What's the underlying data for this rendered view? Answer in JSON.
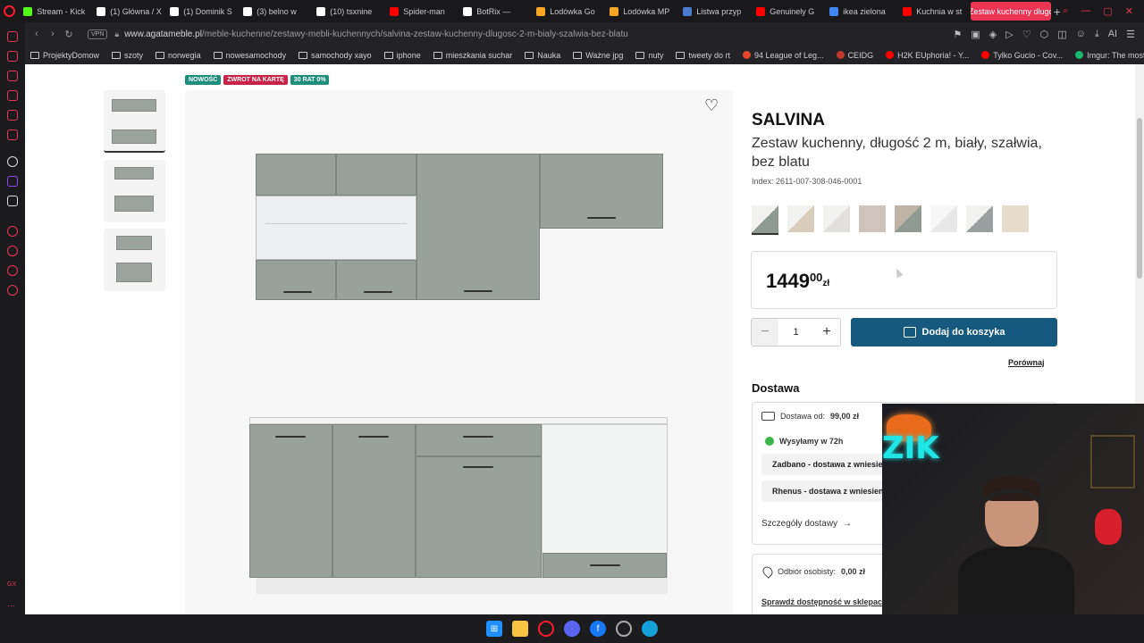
{
  "tabs": [
    {
      "label": "Stream - Kick",
      "favicon": "kick",
      "color": "#53fc18"
    },
    {
      "label": "(1) Główna / X",
      "favicon": "x",
      "color": "#ffffff"
    },
    {
      "label": "(1) Dominik S",
      "favicon": "x",
      "color": "#ffffff"
    },
    {
      "label": "(3) belno w",
      "favicon": "x",
      "color": "#ffffff"
    },
    {
      "label": "(10) tsxnine",
      "favicon": "x",
      "color": "#ffffff"
    },
    {
      "label": "Spider-man",
      "favicon": "youtube",
      "color": "#ff0000"
    },
    {
      "label": "BotRix —",
      "favicon": "botrix",
      "color": "#ffffff"
    },
    {
      "label": "Lodówka Go",
      "favicon": "ceneo",
      "color": "#f5a623"
    },
    {
      "label": "Lodówka MP",
      "favicon": "ceneo",
      "color": "#f5a623"
    },
    {
      "label": "Listwa przyp",
      "favicon": "d",
      "color": "#4a7bd0"
    },
    {
      "label": "Genuinely G",
      "favicon": "youtube",
      "color": "#ff0000"
    },
    {
      "label": "ikea zielona",
      "favicon": "google",
      "color": "#4285f4"
    },
    {
      "label": "Kuchnia w st",
      "favicon": "youtube",
      "color": "#ff0000"
    }
  ],
  "active_tab": "Zestaw kuchenny długo",
  "address": {
    "vpn": "VPN",
    "domain": "www.agatameble.pl",
    "path": "/meble-kuchenne/zestawy-mebli-kuchennych/salvina-zestaw-kuchenny-dlugosc-2-m-bialy-szalwia-bez-blatu"
  },
  "bookmarks": [
    {
      "label": "ProjektyDomow",
      "type": "folder"
    },
    {
      "label": "szoty",
      "type": "folder"
    },
    {
      "label": "norwegia",
      "type": "folder"
    },
    {
      "label": "nowesamochody",
      "type": "folder"
    },
    {
      "label": "samochody xayo",
      "type": "folder"
    },
    {
      "label": "iphone",
      "type": "folder"
    },
    {
      "label": "mieszkania suchar",
      "type": "folder"
    },
    {
      "label": "Nauka",
      "type": "folder"
    },
    {
      "label": "Ważne jpg",
      "type": "folder"
    },
    {
      "label": "nuty",
      "type": "folder"
    },
    {
      "label": "tweety do rt",
      "type": "folder"
    },
    {
      "label": "94 League of Leg...",
      "type": "site",
      "color": "#e8442c"
    },
    {
      "label": "CEIDG",
      "type": "site",
      "color": "#c0392b"
    },
    {
      "label": "H2K EUphoria! - Y...",
      "type": "site",
      "color": "#ff0000"
    },
    {
      "label": "Tylko Gucio - Cov...",
      "type": "site",
      "color": "#ff0000"
    },
    {
      "label": "Imgur: The most a...",
      "type": "site",
      "color": "#1bb76e"
    }
  ],
  "badges": [
    {
      "label": "NOWOŚĆ",
      "color": "#1e8f7b"
    },
    {
      "label": "ZWROT NA KARTĘ",
      "color": "#c8234a"
    },
    {
      "label": "30 RAT 0%",
      "color": "#1e8f7b"
    }
  ],
  "product": {
    "brand": "SALVINA",
    "title": "Zestaw kuchenny, długość 2 m, biały, szałwia, bez blatu",
    "index": "Index: 2611-007-308-046-0001",
    "price_main": "1449",
    "price_cents": "00",
    "price_currency": "zł",
    "quantity": "1",
    "add_to_cart": "Dodaj do koszyka",
    "compare": "Porównaj"
  },
  "swatches": [
    {
      "c1": "#f2f2f0",
      "c2": "#8f9a92"
    },
    {
      "c1": "#f2f2f0",
      "c2": "#d8cdbb"
    },
    {
      "c1": "#f2f2f0",
      "c2": "#e2e0dc"
    },
    {
      "c1": "#cfc4bc",
      "c2": "#cfc4bc"
    },
    {
      "c1": "#bdb3a6",
      "c2": "#8f9a92"
    },
    {
      "c1": "#f7f7f7",
      "c2": "#e8e8e8"
    },
    {
      "c1": "#f2f2f0",
      "c2": "#9aa0a0"
    },
    {
      "c1": "#e6dccb",
      "c2": "#e6dccb"
    }
  ],
  "delivery": {
    "heading": "Dostawa",
    "from_label": "Dostawa od:",
    "from_price": "99,00 zł",
    "ship_time": "Wysyłamy w 72h",
    "option1": "Zadbano - dostawa z wniesieniem",
    "option2": "Rhenus - dostawa z wniesieniem",
    "details_link": "Szczegóły dostawy",
    "pickup_label": "Odbiór osobisty:",
    "pickup_price": "0,00 zł",
    "store_link": "Sprawdź dostępność w sklepach"
  },
  "webcam": {
    "neon_text": "ZIK"
  },
  "colors": {
    "accent": "#ea3554",
    "cart_button": "#155a7e",
    "cabinet": "#98a29a"
  }
}
